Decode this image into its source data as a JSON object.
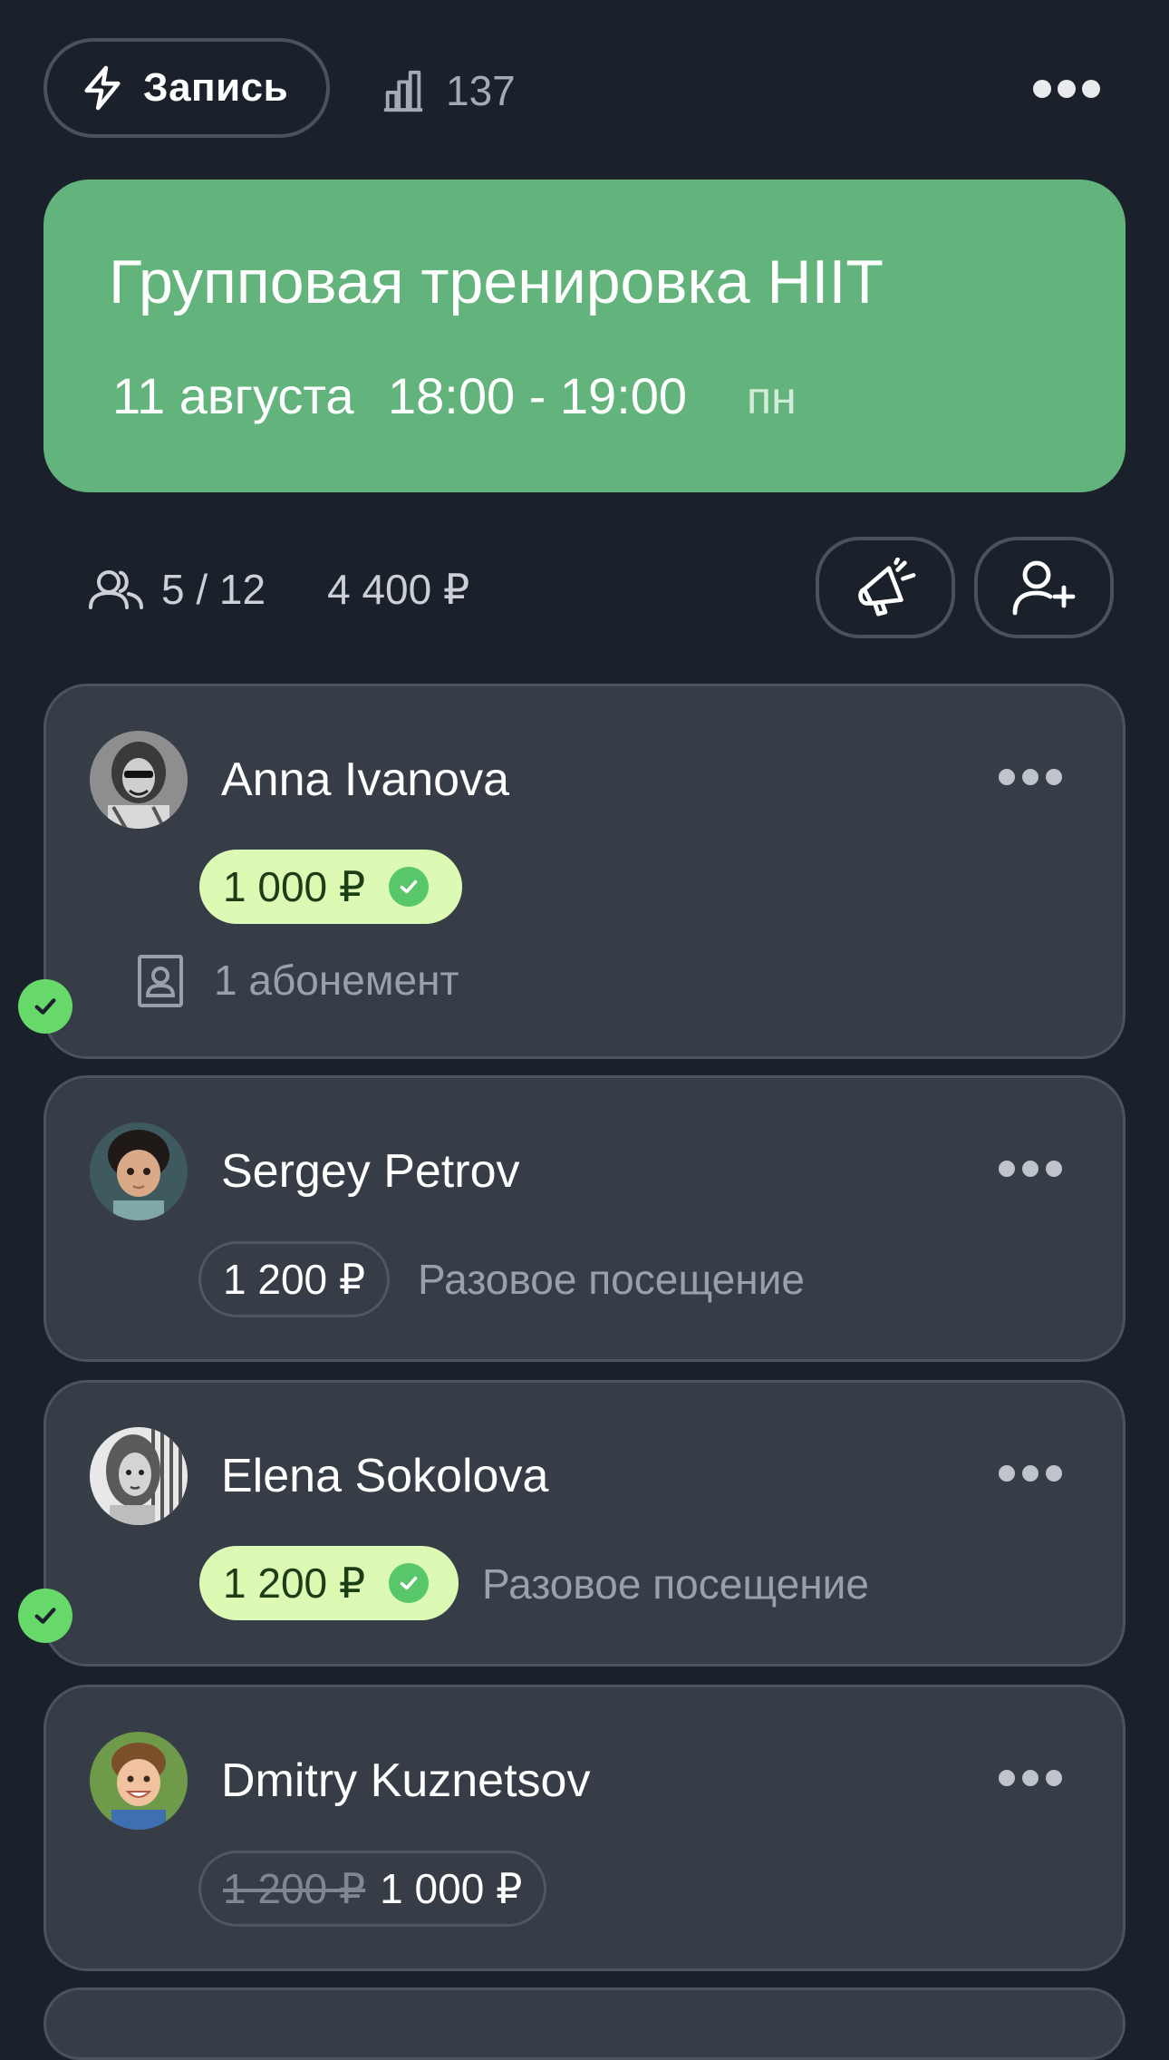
{
  "top_bar": {
    "record_label": "Запись",
    "record_icon": "lightning-icon",
    "stats_icon": "bar-chart-icon",
    "stats_count": "137",
    "more_icon": "more-dots-icon"
  },
  "event": {
    "title": "Групповая тренировка HIIT",
    "date": "11 августа",
    "time": "18:00 - 19:00",
    "weekday": "пн",
    "color": "#62b47c"
  },
  "summary": {
    "participants_icon": "users-icon",
    "participants": "5 / 12",
    "total": "4 400 ₽",
    "announce_icon": "megaphone-icon",
    "add_client_icon": "add-user-icon"
  },
  "clients": [
    {
      "name": "Anna Ivanova",
      "price": "1 000 ₽",
      "paid": true,
      "subscription": "1 абонемент",
      "subscription_icon": "id-card-icon",
      "attended": true
    },
    {
      "name": "Sergey Petrov",
      "price": "1 200 ₽",
      "paid": false,
      "visit_type": "Разовое посещение",
      "attended": false
    },
    {
      "name": "Elena Sokolova",
      "price": "1 200 ₽",
      "paid": true,
      "visit_type": "Разовое посещение",
      "attended": true
    },
    {
      "name": "Dmitry Kuznetsov",
      "old_price": "1 200 ₽",
      "price": "1 000 ₽",
      "paid": false,
      "attended": false
    }
  ],
  "colors": {
    "background": "#1a212b",
    "card": "#363d47",
    "paid_pill": "#ddfab5",
    "attended_badge": "#66d96a"
  }
}
